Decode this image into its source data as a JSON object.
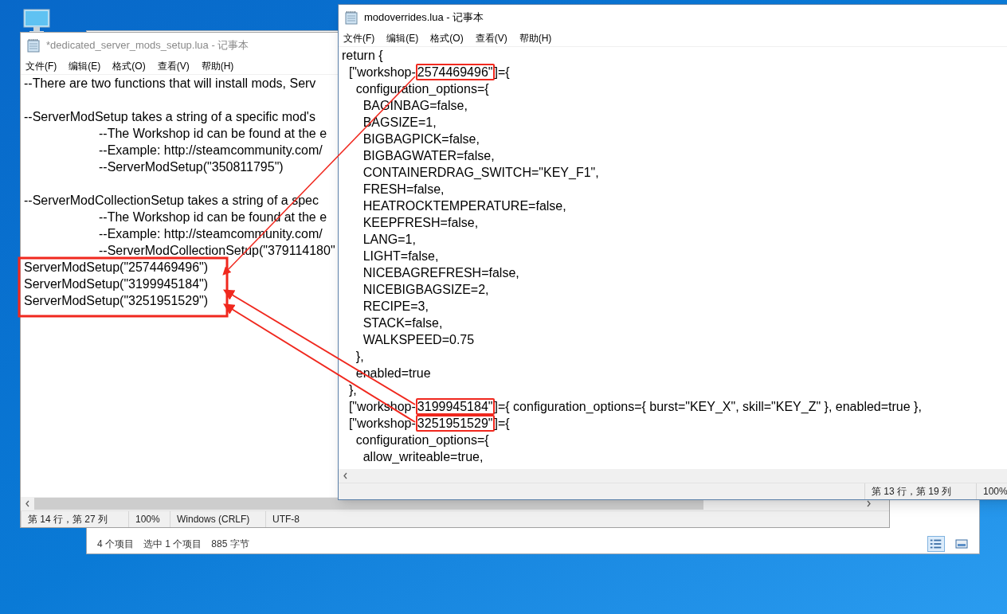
{
  "explorer": {
    "status": [
      "4 个项目",
      "选中 1 个项目",
      "885 字节"
    ]
  },
  "windows": [
    {
      "title": "*dedicated_server_mods_setup.lua - 记事本",
      "active": false,
      "menu": [
        "文件(F)",
        "编辑(E)",
        "格式(O)",
        "查看(V)",
        "帮助(H)"
      ],
      "blocks": [
        {
          "lines": [
            {
              "text": "--There are two functions that will install mods, Serv"
            }
          ]
        },
        {
          "lines": [
            {
              "text": "--ServerModSetup takes a string of a specific mod's"
            },
            {
              "text": "\t--The Workshop id can be found at the e"
            },
            {
              "text": "\t--Example: http://steamcommunity.com/"
            },
            {
              "text": "\t--ServerModSetup(\"350811795\")"
            }
          ]
        },
        {
          "lines": [
            {
              "text": "--ServerModCollectionSetup takes a string of a spec"
            },
            {
              "text": "\t--The Workshop id can be found at the e"
            },
            {
              "text": "\t--Example: http://steamcommunity.com/"
            },
            {
              "text": "\t--ServerModCollectionSetup(\"379114180\""
            },
            {
              "text": "ServerModSetup(\"2574469496\")"
            },
            {
              "text": "ServerModSetup(\"3199945184\")"
            },
            {
              "text": "ServerModSetup(\"3251951529\")"
            }
          ]
        }
      ],
      "status": [
        "第 14 行，第 27 列",
        "100%",
        "Windows (CRLF)",
        "UTF-8"
      ]
    },
    {
      "title": "modoverrides.lua - 记事本",
      "active": true,
      "menu": [
        "文件(F)",
        "编辑(E)",
        "格式(O)",
        "查看(V)",
        "帮助(H)"
      ],
      "blocks": [
        {
          "lines": [
            {
              "text": "return {"
            },
            {
              "text": "  [\"workshop-",
              "highlight": "2574469496\"",
              "after": "]={"
            },
            {
              "text": "    configuration_options={"
            },
            {
              "text": "      BAGINBAG=false,"
            },
            {
              "text": "      BAGSIZE=1,"
            },
            {
              "text": "      BIGBAGPICK=false,"
            },
            {
              "text": "      BIGBAGWATER=false,"
            },
            {
              "text": "      CONTAINERDRAG_SWITCH=\"KEY_F1\","
            },
            {
              "text": "      FRESH=false,"
            },
            {
              "text": "      HEATROCKTEMPERATURE=false,"
            },
            {
              "text": "      KEEPFRESH=false,"
            },
            {
              "text": "      LANG=1,"
            },
            {
              "text": "      LIGHT=false,"
            },
            {
              "text": "      NICEBAGREFRESH=false,"
            },
            {
              "text": "      NICEBIGBAGSIZE=2,"
            },
            {
              "text": "      RECIPE=3,"
            },
            {
              "text": "      STACK=false,"
            },
            {
              "text": "      WALKSPEED=0.75"
            },
            {
              "text": "    },"
            },
            {
              "text": "    enabled=true"
            },
            {
              "text": "  },"
            },
            {
              "text": "  [\"workshop-",
              "highlight": "3199945184\"",
              "after": "]={ configuration_options={ burst=\"KEY_X\", skill=\"KEY_Z\" }, enabled=true },"
            },
            {
              "text": "  [\"workshop-",
              "highlight": "3251951529\"",
              "after": "]={"
            },
            {
              "text": "    configuration_options={"
            },
            {
              "text": "      allow_writeable=true,"
            }
          ]
        }
      ],
      "status": [
        "第 13 行，第 19 列",
        "100%"
      ]
    }
  ]
}
